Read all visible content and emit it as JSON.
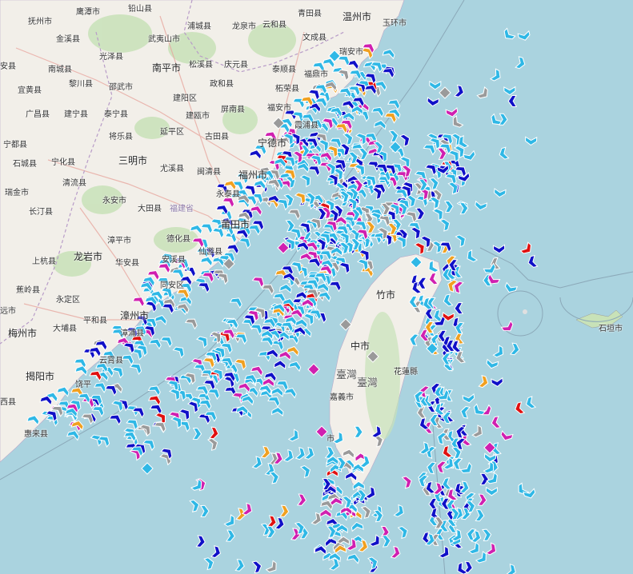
{
  "map": {
    "type": "vessel-traffic-map",
    "colors": {
      "sea": "#aad3df",
      "land": "#f2efe9",
      "forest": "#c8e2b8",
      "road_major": "#e8a8a0",
      "border": "#b89cc8",
      "cargo": "#2fb8e6",
      "tanker": "#1010c8",
      "passenger": "#d020b0",
      "other": "#9a9a9a",
      "fishing": "#f0a020",
      "special": "#e01010"
    },
    "vessel_icon_names": [
      "chevron-vessel-icon",
      "diamond-vessel-icon",
      "anchored-vessel-icon"
    ]
  },
  "labels": {
    "fuzhou_shi_a": "抚州市",
    "yingtan": "鹰潭市",
    "qianshan": "铅山县",
    "qingtian": "青田县",
    "wenzhou": "温州市",
    "yuhuan": "玉环市",
    "luoqing": "乐清市",
    "jinxi": "金溪县",
    "guangze": "光泽县",
    "wuyishan": "武夷山市",
    "pucheng": "浦城县",
    "longquan": "龙泉市",
    "yunhe": "云和县",
    "wencheng": "文成县",
    "ruian": "瑞安市",
    "nancheng": "南城县",
    "shaowu": "邵武市",
    "nanping": "南平市",
    "songxi": "松溪县",
    "qingyuan": "庆元县",
    "taishun": "泰顺县",
    "fuding": "福鼎市",
    "yian": "宜黄县",
    "nanfeng": "南丰县",
    "lichuan": "黎川县",
    "jianyang": "建阳区",
    "zhenghe": "政和县",
    "zherong": "柘荣县",
    "guangchang": "广昌县",
    "jianning": "建宁县",
    "taining": "泰宁县",
    "jianou": "建瓯市",
    "pingnan": "屏南县",
    "zhouning": "周宁县",
    "fuan": "福安市",
    "xiapu": "霞浦县",
    "ningdu": "宁都县",
    "shicheng": "石城县",
    "ninghua": "宁化县",
    "jiangle": "将乐县",
    "shunchang": "顺昌县",
    "yanping": "延平区",
    "gutian": "古田县",
    "ningde": "宁德市",
    "sanming": "三明市",
    "ruijin": "瑞金市",
    "qingliu": "清流县",
    "youxi": "尤溪县",
    "minqing": "闽清县",
    "fuzhou": "福州市",
    "changting": "长汀县",
    "yongan": "永安市",
    "yongtai": "永泰县",
    "datian": "大田县",
    "fujian": "福建省",
    "putian": "莆田市",
    "zhangping": "漳平市",
    "dehua": "德化县",
    "xianyou": "仙游县",
    "shanghang": "上杭县",
    "longyan": "龙岩市",
    "huaan": "华安县",
    "anxi": "安溪县",
    "tongan": "同安区",
    "jiaoling": "蕉岭县",
    "yongding": "永定区",
    "zhangzhou": "漳州市",
    "meizhou": "梅州市",
    "dapu": "大埔县",
    "pinghe": "平和县",
    "zhangpu": "漳浦县",
    "yunxiao": "云霄县",
    "jieyang": "揭阳市",
    "raoping": "饶平",
    "jiexi": "西县",
    "huilai": "惠来县",
    "xinzhu": "竹市",
    "taizhong": "中市",
    "taiwan": "臺灣",
    "taiwan2": "臺灣",
    "hualian": "花蓮縣",
    "jiayi": "嘉義市",
    "shiyuan": "市",
    "shiyuan_tainan": "市",
    "ishigaki": "石垣市",
    "an_xian_edge": "安县",
    "ganxian_edge": "远县",
    "ningdu2": "宁都县",
    "yuan_edge": "远市"
  }
}
